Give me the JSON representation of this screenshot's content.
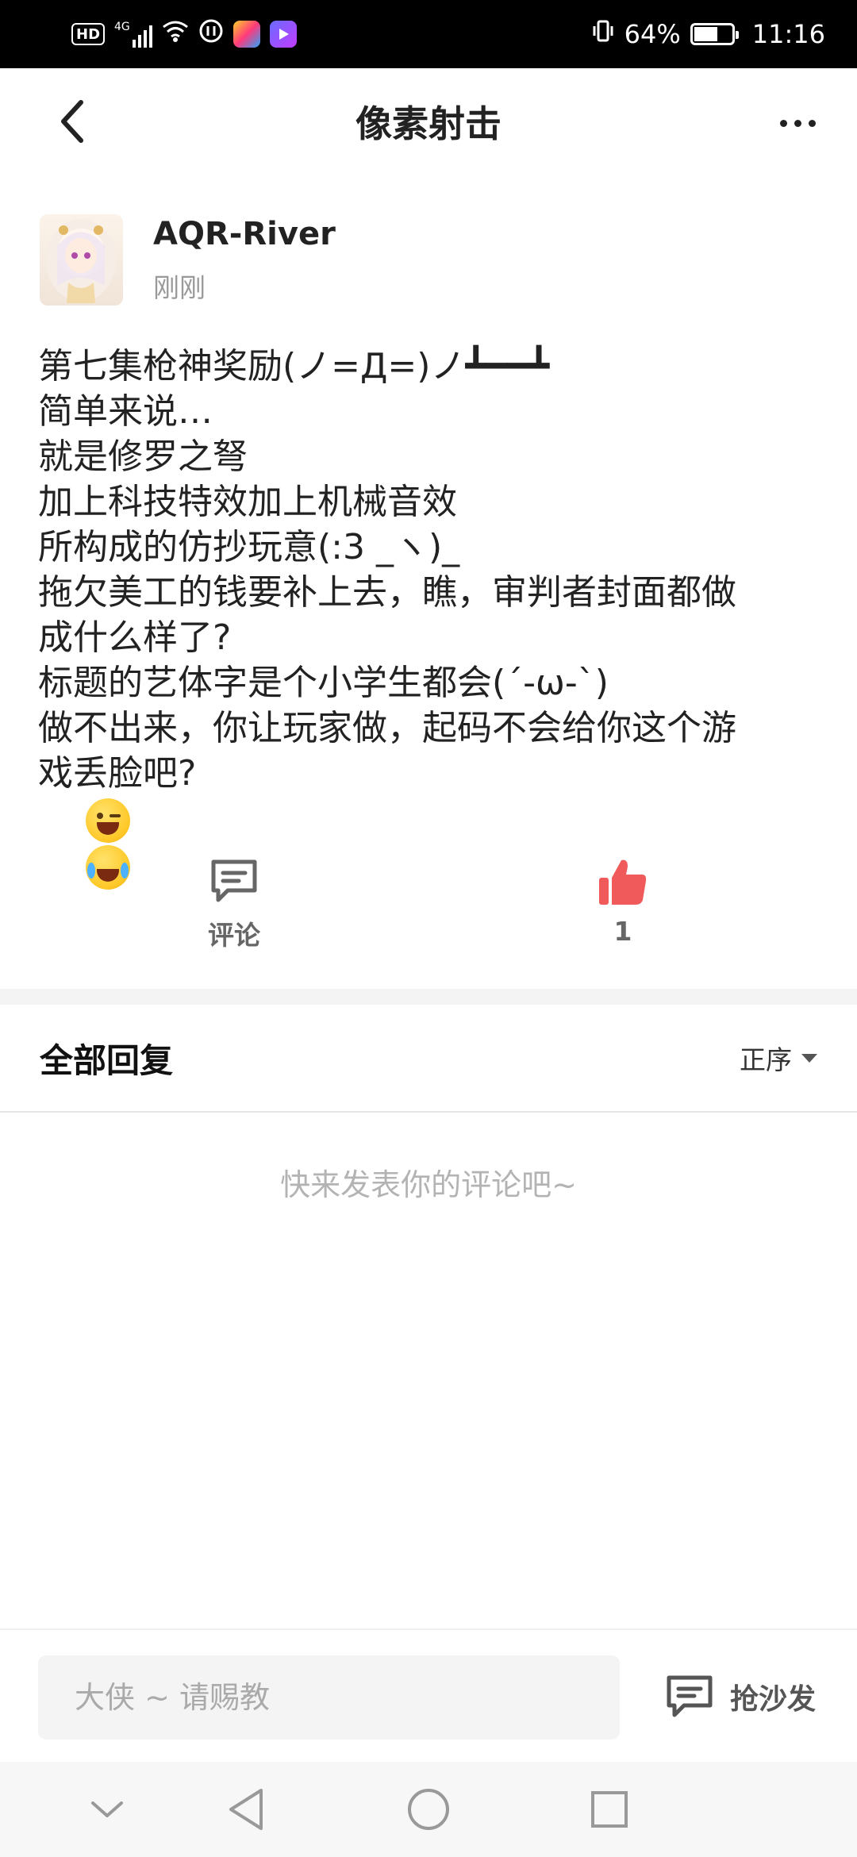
{
  "status_bar": {
    "signal_label": "4G",
    "hd_label": "HD",
    "battery_percent": "64%",
    "battery_level": 0.64,
    "time": "11:16",
    "icons": [
      "hd-icon",
      "signal-icon",
      "wifi-icon",
      "data-saver-icon",
      "app-icon",
      "video-app-icon",
      "vibrate-icon",
      "battery-icon"
    ]
  },
  "header": {
    "title": "像素射击",
    "back_icon": "back-chevron-icon",
    "more_icon": "more-dots-icon"
  },
  "post": {
    "author_name": "AQR-River",
    "timestamp": "刚刚",
    "lines": [
      "第七集枪神奖励(ノ=Д=)ノ┻━━┻",
      "简单来说…",
      "就是修罗之弩",
      "加上科技特效加上机械音效",
      "所构成的仿抄玩意(:3 _ヽ)_",
      "拖欠美工的钱要补上去，瞧，审判者封面都做",
      "成什么样了?",
      "标题的艺体字是个小学生都会(´-ω-`)",
      "做不出来，你让玩家做，起码不会给你这个游",
      "戏丢脸吧?"
    ],
    "trailing_emojis": [
      "wink-tongue-emoji",
      "crying-laughing-emoji"
    ]
  },
  "actions": {
    "comment_label": "评论",
    "like_count": "1",
    "like_color": "#f05a5a"
  },
  "replies": {
    "title": "全部回复",
    "sort_label": "正序",
    "empty_hint": "快来发表你的评论吧~"
  },
  "bottom_bar": {
    "input_placeholder": "大侠 ~ 请赐教",
    "sofa_label": "抢沙发"
  },
  "nav": {
    "icons": [
      "nav-collapse-icon",
      "nav-back-icon",
      "nav-home-icon",
      "nav-recents-icon"
    ]
  }
}
